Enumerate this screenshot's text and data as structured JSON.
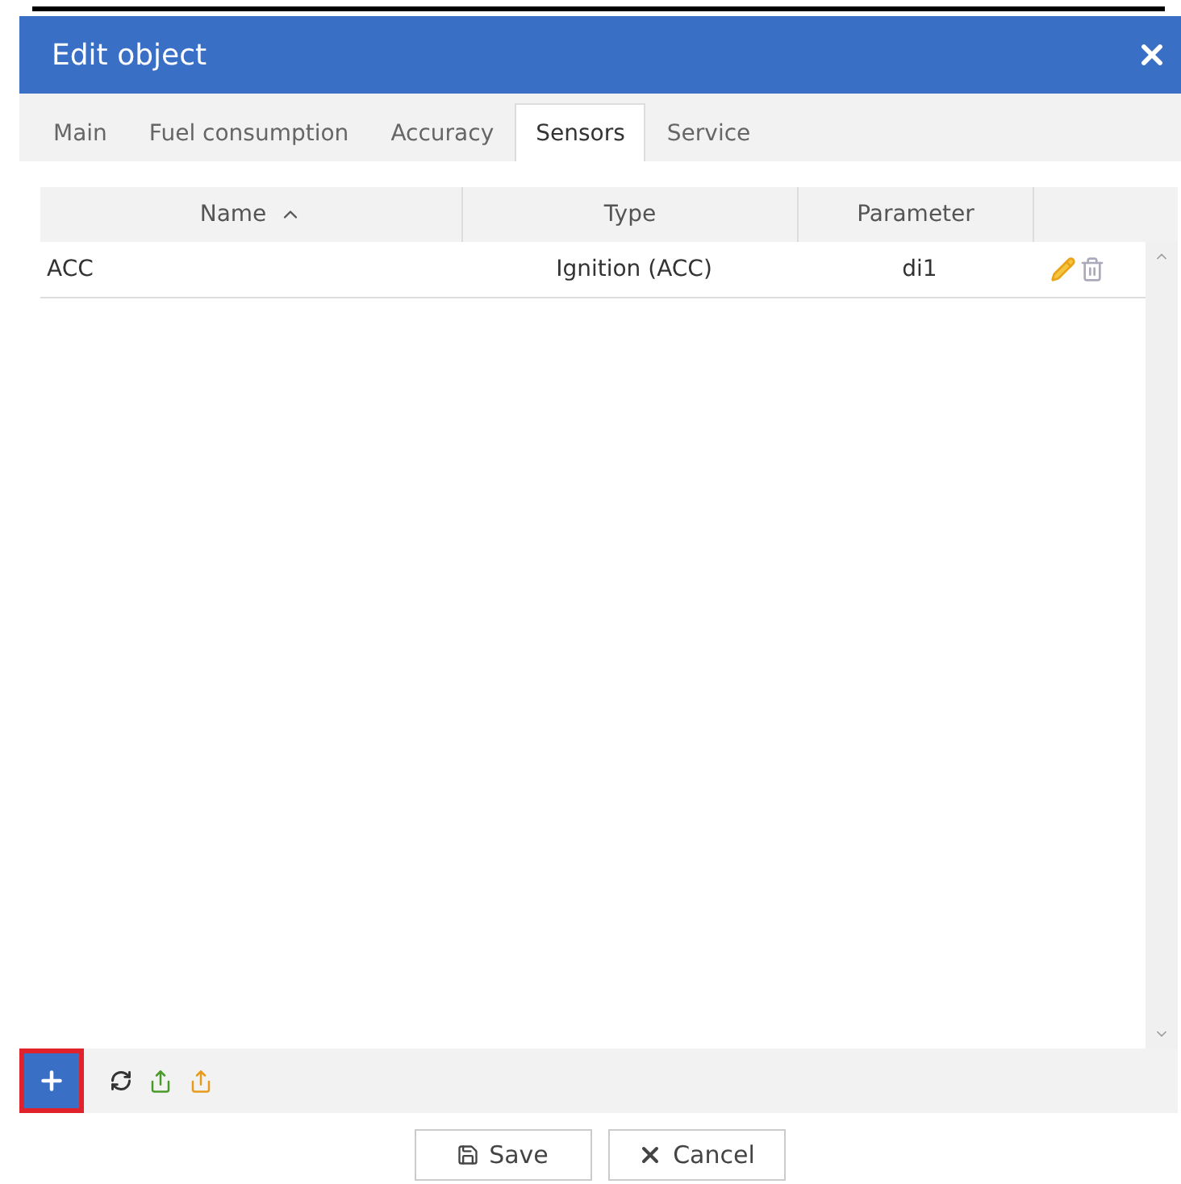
{
  "window": {
    "title": "Edit object"
  },
  "tabs": [
    {
      "label": "Main",
      "selected": false
    },
    {
      "label": "Fuel consumption",
      "selected": false
    },
    {
      "label": "Accuracy",
      "selected": false
    },
    {
      "label": "Sensors",
      "selected": true
    },
    {
      "label": "Service",
      "selected": false
    }
  ],
  "table": {
    "columns": [
      {
        "label": "Name",
        "sorted": true
      },
      {
        "label": "Type",
        "sorted": false
      },
      {
        "label": "Parameter",
        "sorted": false
      }
    ],
    "rows": [
      {
        "name": "ACC",
        "type": "Ignition (ACC)",
        "parameter": "di1"
      }
    ]
  },
  "footer_buttons": [
    {
      "label": "Save",
      "kind": "save"
    },
    {
      "label": "Cancel",
      "kind": "cancel"
    }
  ]
}
